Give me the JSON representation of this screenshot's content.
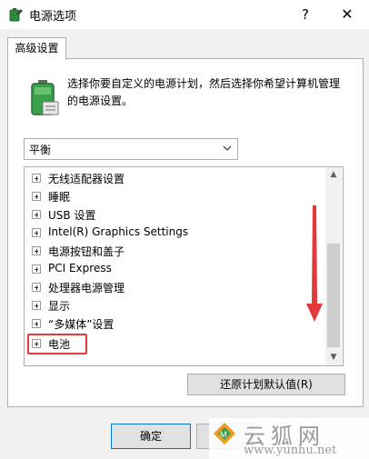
{
  "window": {
    "title": "电源选项",
    "help": "?",
    "close": "✕"
  },
  "tabs": [
    {
      "label": "高级设置"
    }
  ],
  "description": "选择你要自定义的电源计划，然后选择你希望计算机管理的电源设置。",
  "plan_select": {
    "value": "平衡"
  },
  "tree_items": [
    {
      "label": "无线适配器设置"
    },
    {
      "label": "睡眠"
    },
    {
      "label": "USB 设置"
    },
    {
      "label": "Intel(R) Graphics Settings"
    },
    {
      "label": "电源按钮和盖子"
    },
    {
      "label": "PCI Express"
    },
    {
      "label": "处理器电源管理"
    },
    {
      "label": "显示"
    },
    {
      "label": "“多媒体”设置"
    },
    {
      "label": "电池"
    }
  ],
  "buttons": {
    "restore": "还原计划默认值(R)",
    "ok": "确定"
  },
  "watermark": {
    "text": "云狐网",
    "url": "www.yunhu.net"
  },
  "colors": {
    "annotation": "#e03a3a",
    "accent": "#0078d7"
  }
}
